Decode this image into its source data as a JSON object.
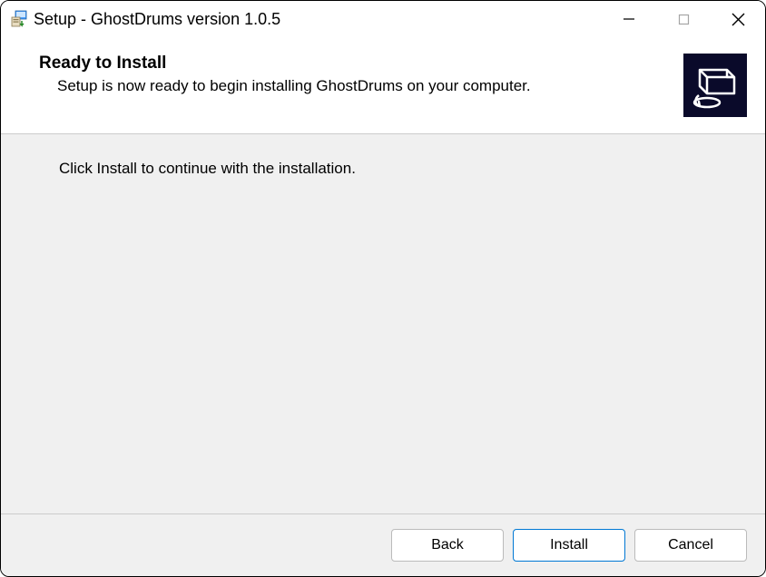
{
  "titlebar": {
    "title": "Setup - GhostDrums version 1.0.5"
  },
  "header": {
    "title": "Ready to Install",
    "subtitle": "Setup is now ready to begin installing GhostDrums on your computer."
  },
  "content": {
    "instruction": "Click Install to continue with the installation."
  },
  "footer": {
    "back_label": "Back",
    "install_label": "Install",
    "cancel_label": "Cancel"
  },
  "icons": {
    "app": "installer-icon",
    "header": "computer-install-icon"
  }
}
